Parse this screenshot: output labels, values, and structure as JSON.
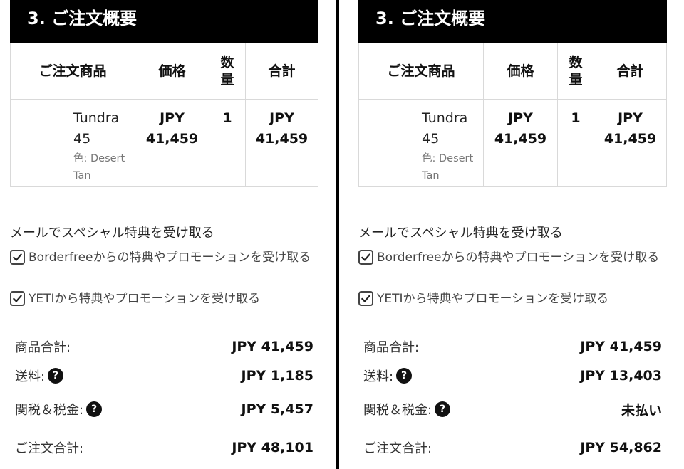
{
  "panels": [
    {
      "header": "3. ご注文概要",
      "columns": {
        "product": "ご注文商品",
        "price": "価格",
        "qty_1": "数",
        "qty_2": "量",
        "total": "合計"
      },
      "item": {
        "name_1": "Tundra",
        "name_2": "45",
        "variant_1": "色: Desert",
        "variant_2": "Tan",
        "price_1": "JPY",
        "price_2": "41,459",
        "qty": "1",
        "total_1": "JPY",
        "total_2": "41,459"
      },
      "mail": {
        "title": "メールでスペシャル特典を受け取る",
        "option1": "Borderfreeからの特典やプロモーションを受け取る",
        "option2": "YETIから特典やプロモーションを受け取る"
      },
      "summary": {
        "subtotal_label": "商品合計:",
        "subtotal": "JPY 41,459",
        "shipping_label": "送料:",
        "shipping": "JPY 1,185",
        "tax_label": "関税＆税金:",
        "tax": "JPY 5,457",
        "total_label": "ご注文合計:",
        "total": "JPY 48,101",
        "help_glyph": "?"
      }
    },
    {
      "header": "3. ご注文概要",
      "columns": {
        "product": "ご注文商品",
        "price": "価格",
        "qty_1": "数",
        "qty_2": "量",
        "total": "合計"
      },
      "item": {
        "name_1": "Tundra",
        "name_2": "45",
        "variant_1": "色: Desert",
        "variant_2": "Tan",
        "price_1": "JPY",
        "price_2": "41,459",
        "qty": "1",
        "total_1": "JPY",
        "total_2": "41,459"
      },
      "mail": {
        "title": "メールでスペシャル特典を受け取る",
        "option1": "Borderfreeからの特典やプロモーションを受け取る",
        "option2": "YETIから特典やプロモーションを受け取る"
      },
      "summary": {
        "subtotal_label": "商品合計:",
        "subtotal": "JPY 41,459",
        "shipping_label": "送料:",
        "shipping": "JPY 13,403",
        "tax_label": "関税＆税金:",
        "tax": "未払い",
        "total_label": "ご注文合計:",
        "total": "JPY 54,862",
        "help_glyph": "?"
      }
    }
  ],
  "icons": {
    "checkbox": "check-icon",
    "help": "question-circle-icon"
  },
  "colors": {
    "header_bg": "#000000",
    "header_text": "#ffffff",
    "border": "#d9d9d9",
    "divider": "#000000"
  }
}
